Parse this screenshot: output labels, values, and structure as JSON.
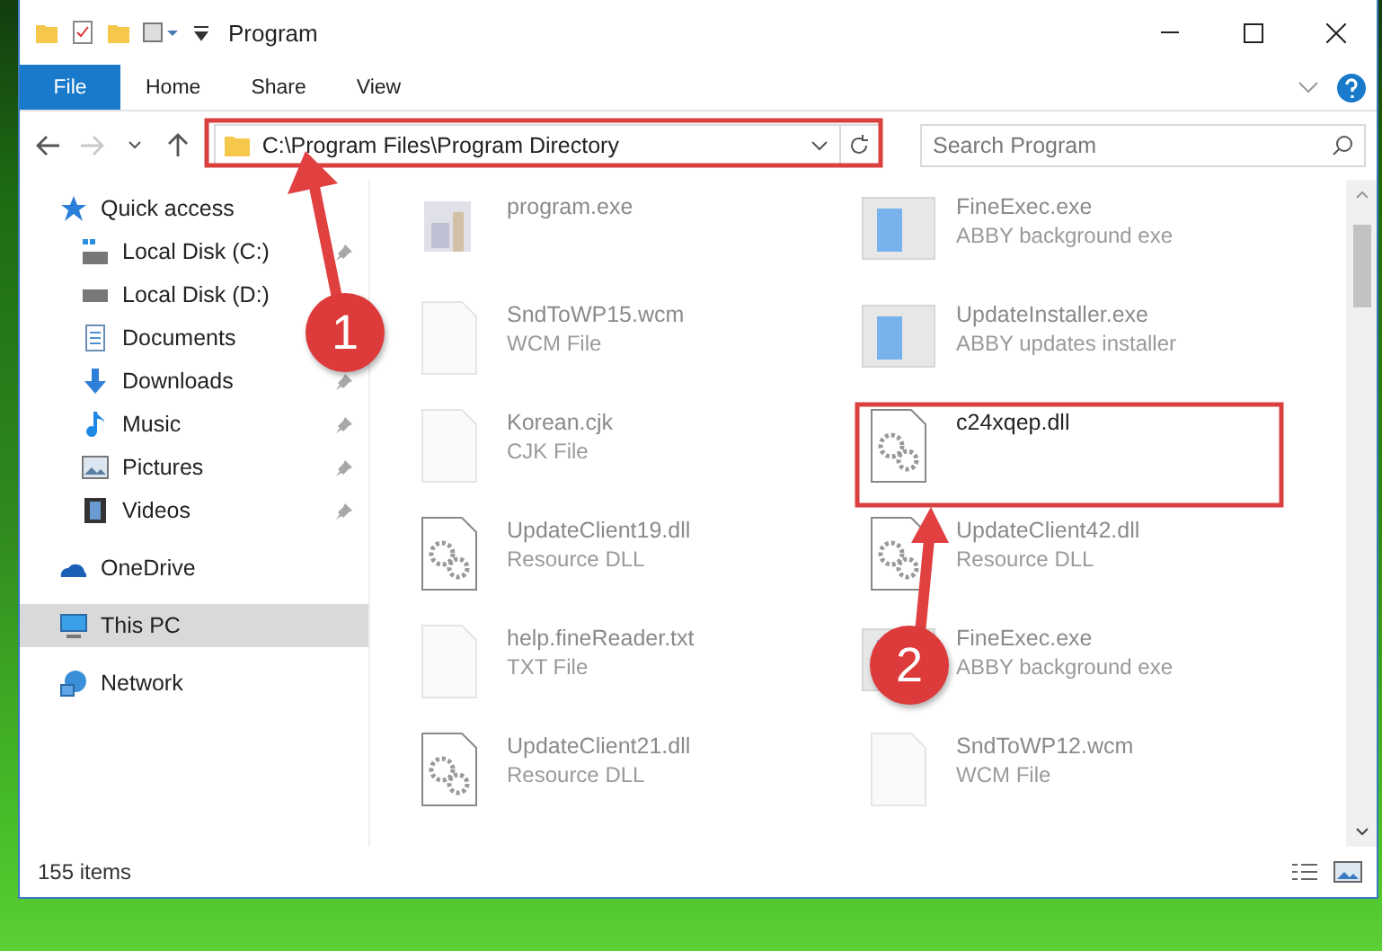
{
  "window": {
    "title": "Program"
  },
  "ribbon_tabs": [
    {
      "label": "File",
      "kind": "file"
    },
    {
      "label": "Home",
      "kind": "tab"
    },
    {
      "label": "Share",
      "kind": "tab"
    },
    {
      "label": "View",
      "kind": "tab"
    }
  ],
  "address_bar": {
    "path": "C:\\Program Files\\Program Directory"
  },
  "search": {
    "placeholder": "Search Program"
  },
  "sidebar": {
    "items": [
      {
        "label": "Quick access",
        "kind": "star",
        "selected": false,
        "children": [
          {
            "label": "Local Disk (C:)",
            "kind": "drive-c",
            "pinned": true,
            "selected": false
          },
          {
            "label": "Local Disk (D:)",
            "kind": "drive",
            "pinned": false,
            "selected": false
          },
          {
            "label": "Documents",
            "kind": "documents",
            "pinned": false,
            "selected": false
          },
          {
            "label": "Downloads",
            "kind": "download",
            "pinned": true,
            "selected": false
          },
          {
            "label": "Music",
            "kind": "music",
            "pinned": true,
            "selected": false
          },
          {
            "label": "Pictures",
            "kind": "pictures",
            "pinned": true,
            "selected": false
          },
          {
            "label": "Videos",
            "kind": "videos",
            "pinned": true,
            "selected": false
          }
        ]
      },
      {
        "label": "OneDrive",
        "kind": "cloud",
        "selected": false
      },
      {
        "label": "This PC",
        "kind": "pc",
        "selected": true
      },
      {
        "label": "Network",
        "kind": "network",
        "selected": false
      }
    ]
  },
  "files": [
    {
      "name": "program.exe",
      "kind": "app",
      "faded": true
    },
    {
      "name": "FineExec.exe",
      "type": "ABBY background exe",
      "kind": "window",
      "faded": true
    },
    {
      "name": "SndToWP15.wcm",
      "type": "WCM File",
      "kind": "blank",
      "faded": true
    },
    {
      "name": "UpdateInstaller.exe",
      "type": "ABBY updates installer",
      "kind": "window",
      "faded": true
    },
    {
      "name": "Korean.cjk",
      "type": "CJK File",
      "kind": "blank",
      "faded": true
    },
    {
      "name": "c24xqep.dll",
      "kind": "gear",
      "faded": false
    },
    {
      "name": "UpdateClient19.dll",
      "type": "Resource DLL",
      "kind": "gear",
      "faded": true
    },
    {
      "name": "UpdateClient42.dll",
      "type": "Resource DLL",
      "kind": "gear",
      "faded": true
    },
    {
      "name": "help.fineReader.txt",
      "type": "TXT File",
      "kind": "blank",
      "faded": true
    },
    {
      "name": "FineExec.exe",
      "type": "ABBY background exe",
      "kind": "window",
      "faded": true
    },
    {
      "name": "UpdateClient21.dll",
      "type": "Resource DLL",
      "kind": "gear",
      "faded": true
    },
    {
      "name": "SndToWP12.wcm",
      "type": "WCM File",
      "kind": "blank",
      "faded": true
    }
  ],
  "status_bar": {
    "count": "155 items"
  },
  "annotations": [
    {
      "number": "1"
    },
    {
      "number": "2"
    }
  ]
}
